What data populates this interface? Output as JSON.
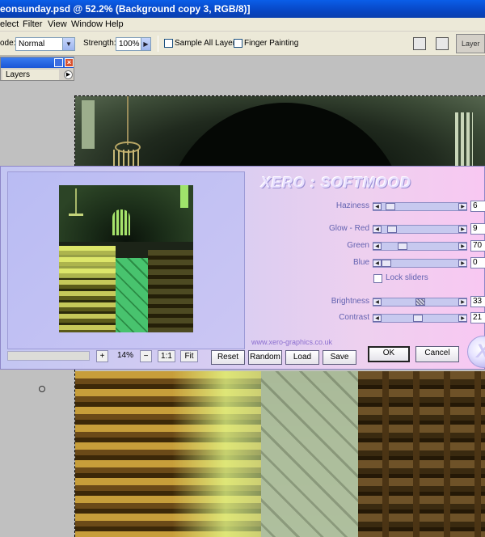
{
  "window": {
    "title": "eonsunday.psd @ 52.2% (Background copy 3, RGB/8)]"
  },
  "menubar": {
    "items": [
      {
        "label": "elect"
      },
      {
        "label": "Filter"
      },
      {
        "label": "View"
      },
      {
        "label": "Window"
      },
      {
        "label": "Help"
      }
    ]
  },
  "options": {
    "mode_label": "ode:",
    "mode_value": "Normal",
    "strength_label": "Strength:",
    "strength_value": "100%",
    "sample_all_layers": "Sample All Layers",
    "finger_painting": "Finger Painting",
    "palette_well": "Layer"
  },
  "layers_panel": {
    "tab_label": "Layers"
  },
  "plugin": {
    "brand": "XERO : SOFTMOOD",
    "params": [
      {
        "label": "Haziness",
        "value": "6",
        "level": 0.06
      },
      {
        "label": "Glow - Red",
        "value": "9",
        "level": 0.09
      },
      {
        "label": "Green",
        "value": "70",
        "level": 0.25
      },
      {
        "label": "Blue",
        "value": "0",
        "level": 0.0
      }
    ],
    "lock_sliders": "Lock sliders",
    "params2": [
      {
        "label": "Brightness",
        "value": "33",
        "level": 0.52
      },
      {
        "label": "Contrast",
        "value": "21",
        "level": 0.48
      }
    ],
    "url": "www.xero-graphics.co.uk",
    "zoom": {
      "plus": "+",
      "value": "14%",
      "minus": "−",
      "one_to_one": "1:1",
      "fit": "Fit"
    },
    "buttons": {
      "reset": "Reset",
      "random": "Random",
      "load": "Load",
      "save": "Save",
      "ok": "OK",
      "cancel": "Cancel"
    }
  },
  "colors": {
    "titlebar": "#0846c4",
    "dialog_left": "#c3c6f2",
    "dialog_right": "#f8c8f2",
    "label_text": "#6262b0"
  }
}
